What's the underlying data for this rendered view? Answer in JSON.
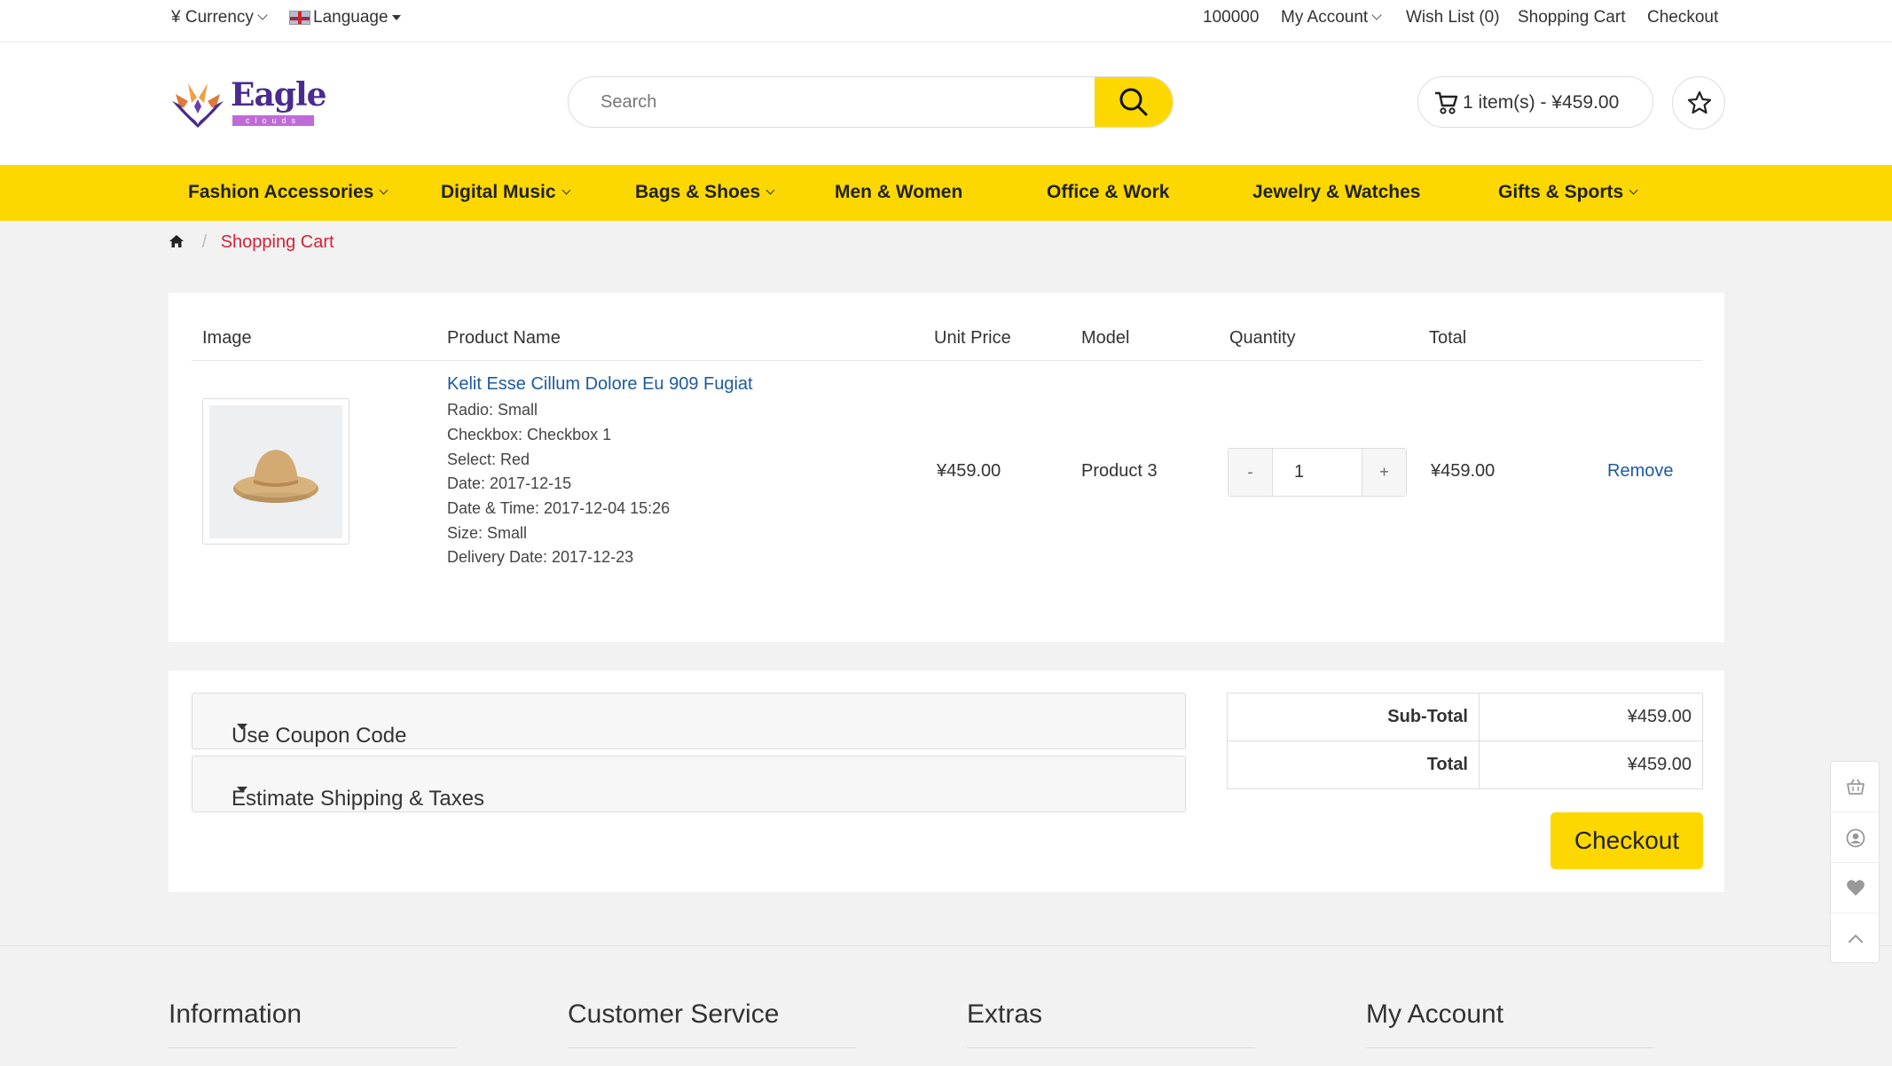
{
  "topbar": {
    "currency_symbol": "¥",
    "currency_label": "Currency",
    "language_label": "Language",
    "phone": "100000",
    "my_account": "My Account",
    "wish_list": "Wish List (0)",
    "shopping_cart": "Shopping Cart",
    "checkout": "Checkout"
  },
  "header": {
    "logo_text": "Eagle",
    "logo_sub": "clouds",
    "search_placeholder": "Search",
    "cart_summary": "1 item(s) - ¥459.00"
  },
  "nav": [
    {
      "label": "Fashion Accessories",
      "has_dropdown": true
    },
    {
      "label": "Digital Music",
      "has_dropdown": true
    },
    {
      "label": "Bags & Shoes",
      "has_dropdown": true
    },
    {
      "label": "Men & Women",
      "has_dropdown": false
    },
    {
      "label": "Office & Work",
      "has_dropdown": false
    },
    {
      "label": "Jewelry & Watches",
      "has_dropdown": false
    },
    {
      "label": "Gifts & Sports",
      "has_dropdown": true
    }
  ],
  "breadcrumb": {
    "current": "Shopping Cart"
  },
  "cart_table": {
    "headers": [
      "Image",
      "Product Name",
      "Unit Price",
      "Model",
      "Quantity",
      "Total"
    ],
    "rows": [
      {
        "name": "Kelit Esse Cillum Dolore Eu 909 Fugiat",
        "options": [
          "Radio: Small",
          "Checkbox: Checkbox 1",
          "Select: Red",
          "Date: 2017-12-15",
          "Date & Time: 2017-12-04 15:26",
          "Size: Small",
          "Delivery Date: 2017-12-23"
        ],
        "unit_price": "¥459.00",
        "model": "Product 3",
        "quantity": "1",
        "minus": "-",
        "plus": "+",
        "total": "¥459.00",
        "remove": "Remove"
      }
    ]
  },
  "coupon": {
    "label": "Use Coupon Code"
  },
  "shipping": {
    "label": "Estimate Shipping & Taxes"
  },
  "totals": {
    "subtotal_label": "Sub-Total",
    "subtotal_value": "¥459.00",
    "total_label": "Total",
    "total_value": "¥459.00"
  },
  "checkout_button": "Checkout",
  "footer": {
    "columns": [
      "Information",
      "Customer Service",
      "Extras",
      "My Account"
    ]
  },
  "colors": {
    "accent": "#fdd800",
    "link": "#1d5aa0",
    "breadcrumb_active": "#d32338"
  }
}
